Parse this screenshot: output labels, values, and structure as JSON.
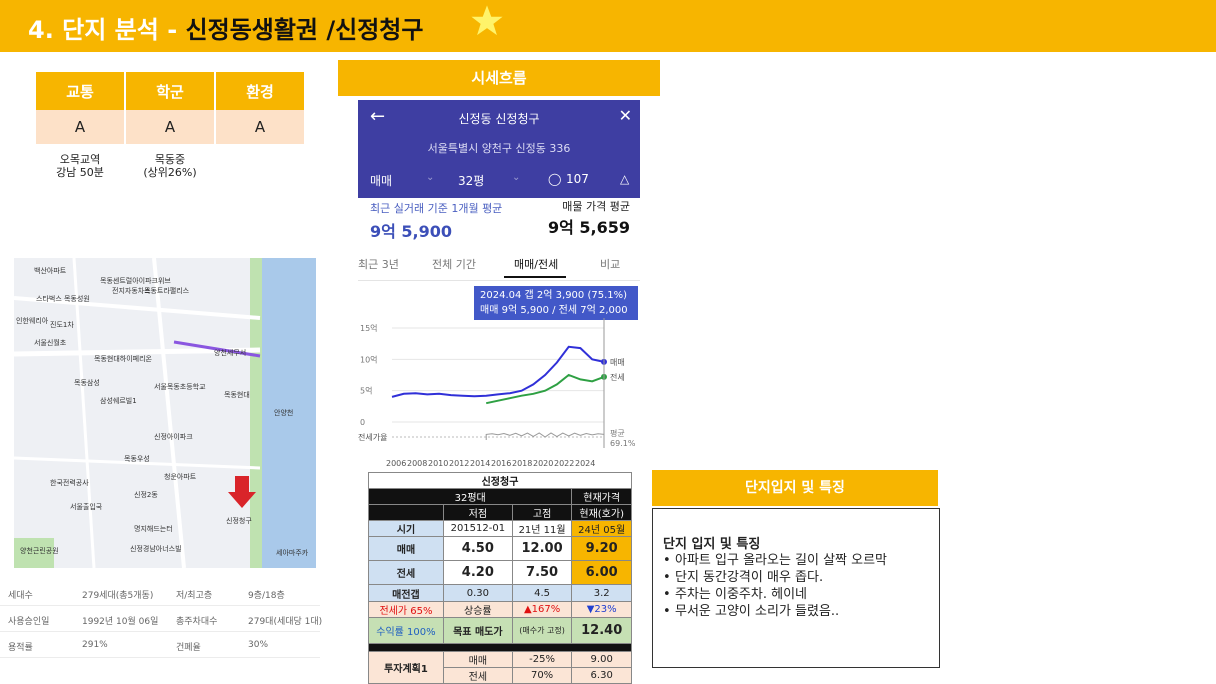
{
  "header": {
    "title_prefix": "4. 단지 분석 - ",
    "title_main": "신정동생활권 /신정청구",
    "star_icon": "star-icon",
    "bg_color": "#f7b500"
  },
  "grades": {
    "headers": [
      "교통",
      "학군",
      "환경"
    ],
    "values": [
      "A",
      "A",
      "A"
    ],
    "notes": [
      "오목교역\n강남 50분",
      "목동중\n(상위26%)",
      ""
    ]
  },
  "trend": {
    "title": "시세흐름",
    "app": {
      "name": "신정동 신정청구",
      "address": "서울특별시 양천구 신정동 336",
      "deal_type": "매매",
      "size": "32평",
      "comments": "107",
      "recent_label": "최근 실거래 기준 1개월 평균",
      "recent_value": "9억 5,900",
      "listing_label": "매물 가격 평균",
      "listing_value": "9억 5,659",
      "period_tabs": [
        "최근 3년",
        "전체 기간",
        "매매/전세",
        "비교"
      ],
      "tooltip_line1": "2024.04  갭 2억 3,900 (75.1%)",
      "tooltip_line2": "매매 9억 5,900 / 전세 7억 2,000",
      "y_ticks": [
        "15억",
        "10억",
        "5억",
        "0"
      ],
      "ratio_label": "전세가율",
      "legend_sale": "매매",
      "legend_jeonse": "전세",
      "legend_avg": "평균",
      "legend_avg_pct": "69.1%",
      "x_ticks": [
        "2006",
        "2008",
        "2010",
        "2012",
        "2014",
        "2016",
        "2018",
        "2020",
        "2022",
        "2024"
      ]
    }
  },
  "chart_data": {
    "type": "line",
    "x": [
      2006,
      2007,
      2008,
      2009,
      2010,
      2011,
      2012,
      2013,
      2014,
      2015,
      2016,
      2017,
      2018,
      2019,
      2020,
      2021,
      2022,
      2023,
      2024
    ],
    "series": [
      {
        "name": "매매",
        "values": [
          4.0,
          4.5,
          4.6,
          4.4,
          4.5,
          4.3,
          4.2,
          4.1,
          4.2,
          4.4,
          4.6,
          5.0,
          6.0,
          7.5,
          9.5,
          12.0,
          11.8,
          10.0,
          9.59
        ]
      },
      {
        "name": "전세",
        "values": [
          null,
          null,
          null,
          null,
          null,
          null,
          null,
          null,
          3.0,
          3.4,
          3.8,
          4.2,
          4.5,
          5.0,
          6.0,
          7.5,
          6.8,
          6.5,
          7.2
        ]
      }
    ],
    "ylim": [
      0,
      15
    ],
    "y_ticks": [
      "15억",
      "10억",
      "5억",
      "0"
    ],
    "colors": {
      "매매": "#3030d8",
      "전세": "#2ea043"
    }
  },
  "investment": {
    "title": "신정청구",
    "col_32": "32평대",
    "col_current": "현재가격",
    "col_low": "저점",
    "col_high": "고점",
    "col_now": "현재(호가)",
    "row_period": {
      "label": "시기",
      "low": "201512-01",
      "high": "21년 11월",
      "now": "24년 05월"
    },
    "row_sale": {
      "label": "매매",
      "low": "4.50",
      "high": "12.00",
      "now": "9.20"
    },
    "row_jeonse": {
      "label": "전세",
      "low": "4.20",
      "high": "7.50",
      "now": "6.00"
    },
    "row_gap": {
      "label": "매전갭",
      "low": "0.30",
      "high": "4.5",
      "now": "3.2"
    },
    "row_rise": {
      "label_red": "전세가 65%",
      "label": "상승률",
      "high": "▲167%",
      "now": "▼23%"
    },
    "row_target": {
      "label": "수익률 100%",
      "label2": "목표 매도가",
      "note": "(매수가 고정)",
      "value": "12.40"
    },
    "row_plan": {
      "label": "투자계획1",
      "sale": "매매",
      "sale_pct": "-25%",
      "sale_val": "9.00",
      "jeonse": "전세",
      "jeonse_pct": "70%",
      "jeonse_val": "6.30"
    }
  },
  "info": {
    "rows": [
      [
        "세대수",
        "279세대(총5개동)",
        "저/최고층",
        "9층/18층"
      ],
      [
        "사용승인일",
        "1992년 10월 06일",
        "총주차대수",
        "279대(세대당 1대)"
      ],
      [
        "용적률",
        "291%",
        "건폐율",
        "30%"
      ]
    ]
  },
  "map_labels": [
    "백산아파트",
    "목동센트럴아이파크위브",
    "전지자동차스",
    "스타벅스",
    "목동성원",
    "목동트라팰리스",
    "인한웨리아",
    "진도1차",
    "서울신월초",
    "목동현대하이페리온",
    "삼성쉐르빌1",
    "목동삼성",
    "신정아이파크",
    "청운아파트",
    "서울목동초등학교",
    "목동현대",
    "양천세무서",
    "안양천",
    "목동우성",
    "한국전력공사",
    "서울출입국",
    "신정2동",
    "명지해드는터",
    "신정청구",
    "신정경남아너스빌",
    "세아마주카",
    "양천근린공원"
  ],
  "features": {
    "header": "단지입지 및 특징",
    "title": "단지 입지 및 특징",
    "items": [
      "아파트 입구 올라오는 길이 살짝 오르막",
      "단지 동간강격이 매우 좁다.",
      "주차는 이중주차. 헤이네",
      "무서운 고양이 소리가 들렸음.."
    ]
  }
}
